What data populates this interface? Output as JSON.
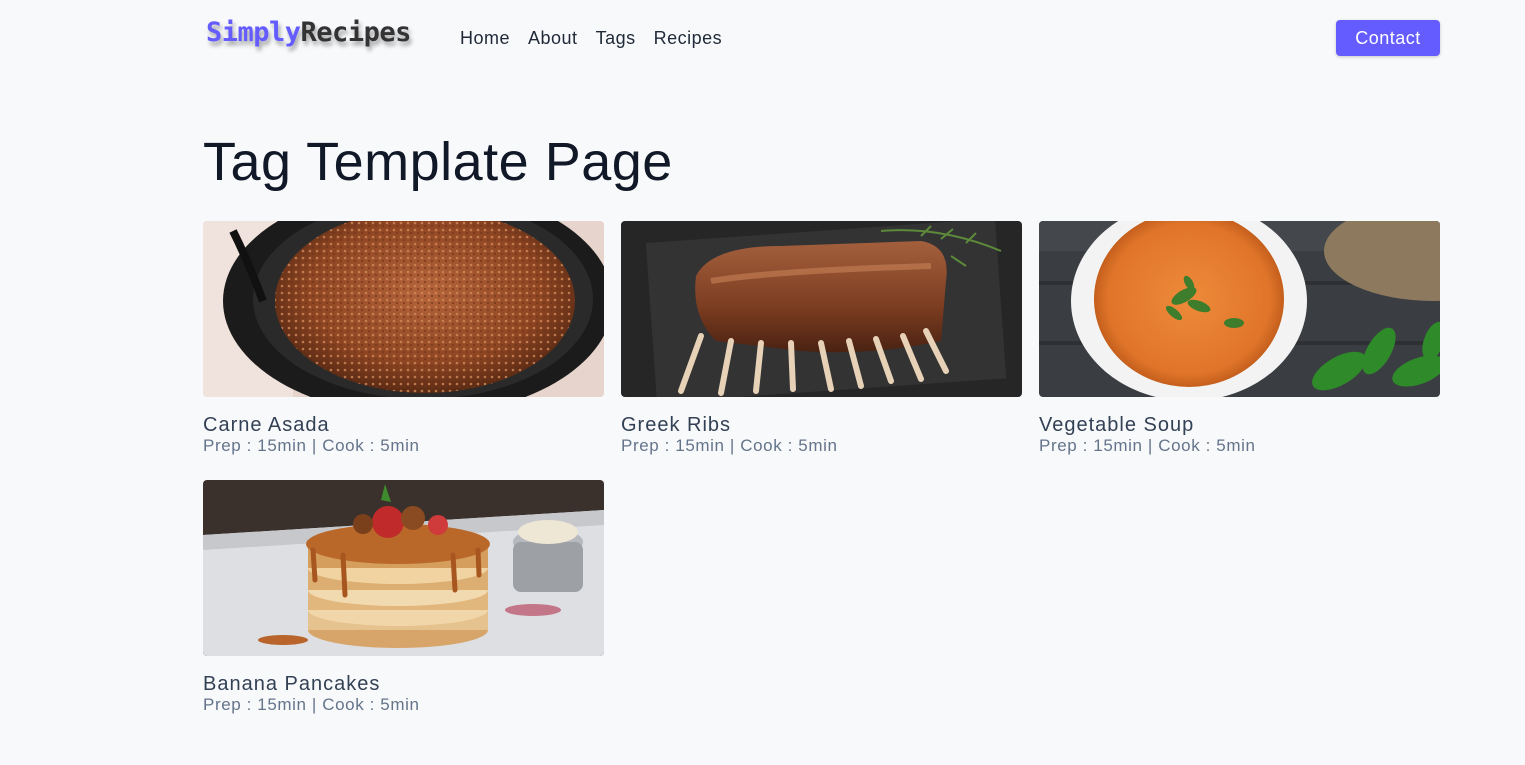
{
  "nav": {
    "logo_accent": "Simply",
    "logo_rest": "Recipes",
    "links": [
      "Home",
      "About",
      "Tags",
      "Recipes"
    ],
    "contact_label": "Contact"
  },
  "page": {
    "title": "Tag Template Page"
  },
  "recipes": [
    {
      "name": "Carne Asada",
      "meta": "Prep : 15min | Cook : 5min",
      "image": "carne-asada-photo"
    },
    {
      "name": "Greek Ribs",
      "meta": "Prep : 15min | Cook : 5min",
      "image": "greek-ribs-photo"
    },
    {
      "name": "Vegetable Soup",
      "meta": "Prep : 15min | Cook : 5min",
      "image": "vegetable-soup-photo"
    },
    {
      "name": "Banana Pancakes",
      "meta": "Prep : 15min | Cook : 5min",
      "image": "banana-pancakes-photo"
    }
  ],
  "colors": {
    "accent": "#645cff",
    "background": "#f8f9fb"
  }
}
